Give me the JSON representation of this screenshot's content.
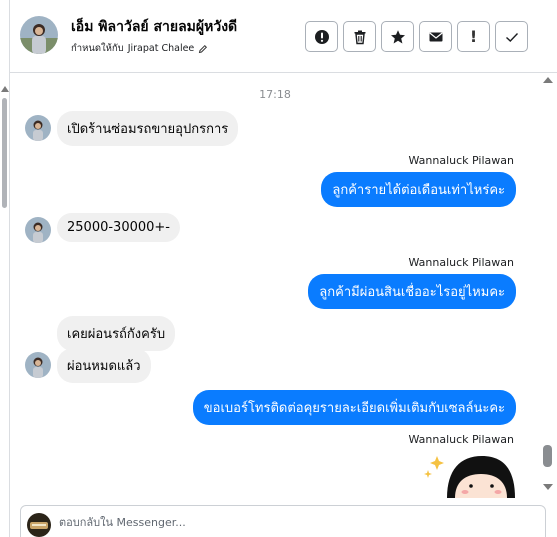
{
  "header": {
    "contact_name": "เอ็ม พิลาวัลย์ สายลมผู้หวังดี",
    "assigned_prefix": "กำหนดให้กับ",
    "assigned_to": "Jirapat Chalee",
    "actions": [
      {
        "name": "spam-button",
        "icon": "exclamation-circle-icon"
      },
      {
        "name": "delete-button",
        "icon": "trash-icon"
      },
      {
        "name": "star-button",
        "icon": "star-icon"
      },
      {
        "name": "mark-unread-button",
        "icon": "envelope-icon",
        "label": ""
      },
      {
        "name": "important-button",
        "icon": "exclamation-icon",
        "label": "!"
      },
      {
        "name": "done-button",
        "icon": "checkmark-icon"
      }
    ]
  },
  "conversation": {
    "timestamp": "17:18",
    "messages": [
      {
        "direction": "incoming",
        "text": "เปิดร้านซ่อมรถขายอุปกรการ"
      },
      {
        "direction": "outgoing",
        "sender": "Wannaluck Pilawan",
        "text": "ลูกค้ารายได้ต่อเดือนเท่าไหร่คะ"
      },
      {
        "direction": "incoming",
        "text": "25000-30000+-"
      },
      {
        "direction": "outgoing",
        "sender": "Wannaluck Pilawan",
        "text": "ลูกค้ามีผ่อนสินเชื่ออะไรอยู่ไหมคะ"
      },
      {
        "direction": "incoming",
        "text": "เคยผ่อนรถ์กังครับ"
      },
      {
        "direction": "incoming",
        "text": "ผ่อนหมดแล้ว"
      },
      {
        "direction": "outgoing",
        "text": "ขอเบอร์โทรติดต่อคุยรายละเอียดเพิ่มเติมกับเซลล์นะคะ"
      },
      {
        "direction": "outgoing",
        "sender": "Wannaluck Pilawan",
        "sticker": "girl-sticker-icon"
      }
    ]
  },
  "composer": {
    "placeholder": "ตอบกลับใน Messenger..."
  },
  "colors": {
    "outgoing_bubble": "#0a7cff",
    "incoming_bubble": "#f0f0f0"
  }
}
